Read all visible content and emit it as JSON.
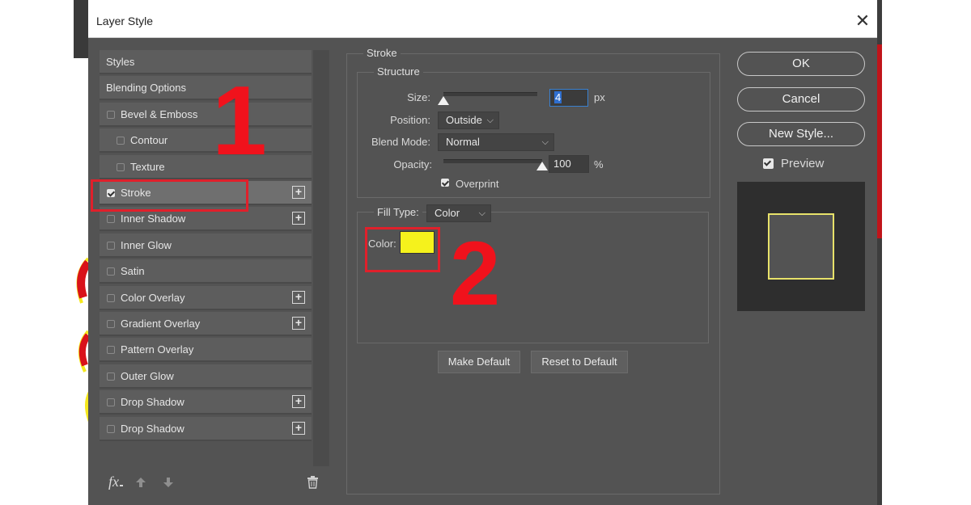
{
  "dialog": {
    "title": "Layer Style",
    "close": "✕"
  },
  "styles_list": [
    {
      "label": "Styles",
      "checkbox": false,
      "checked": false,
      "plus": false,
      "indent": false,
      "selected": false
    },
    {
      "label": "Blending Options",
      "checkbox": false,
      "checked": false,
      "plus": false,
      "indent": false,
      "selected": false
    },
    {
      "label": "Bevel & Emboss",
      "checkbox": true,
      "checked": false,
      "plus": false,
      "indent": false,
      "selected": false
    },
    {
      "label": "Contour",
      "checkbox": true,
      "checked": false,
      "plus": false,
      "indent": true,
      "selected": false
    },
    {
      "label": "Texture",
      "checkbox": true,
      "checked": false,
      "plus": false,
      "indent": true,
      "selected": false
    },
    {
      "label": "Stroke",
      "checkbox": true,
      "checked": true,
      "plus": true,
      "indent": false,
      "selected": true
    },
    {
      "label": "Inner Shadow",
      "checkbox": true,
      "checked": false,
      "plus": true,
      "indent": false,
      "selected": false
    },
    {
      "label": "Inner Glow",
      "checkbox": true,
      "checked": false,
      "plus": false,
      "indent": false,
      "selected": false
    },
    {
      "label": "Satin",
      "checkbox": true,
      "checked": false,
      "plus": false,
      "indent": false,
      "selected": false
    },
    {
      "label": "Color Overlay",
      "checkbox": true,
      "checked": false,
      "plus": true,
      "indent": false,
      "selected": false
    },
    {
      "label": "Gradient Overlay",
      "checkbox": true,
      "checked": false,
      "plus": true,
      "indent": false,
      "selected": false
    },
    {
      "label": "Pattern Overlay",
      "checkbox": true,
      "checked": false,
      "plus": false,
      "indent": false,
      "selected": false
    },
    {
      "label": "Outer Glow",
      "checkbox": true,
      "checked": false,
      "plus": false,
      "indent": false,
      "selected": false
    },
    {
      "label": "Drop Shadow",
      "checkbox": true,
      "checked": false,
      "plus": true,
      "indent": false,
      "selected": false
    },
    {
      "label": "Drop Shadow",
      "checkbox": true,
      "checked": false,
      "plus": true,
      "indent": false,
      "selected": false
    }
  ],
  "bottom_bar": {
    "fx": "fx",
    "icons": [
      "fx-icon",
      "arrow-up-icon",
      "arrow-down-icon",
      "trash-icon"
    ]
  },
  "stroke": {
    "group_title": "Stroke",
    "structure_title": "Structure",
    "size_label": "Size:",
    "size_value": "4",
    "size_unit": "px",
    "size_level": 0.0,
    "position_label": "Position:",
    "position_value": "Outside",
    "blend_label": "Blend Mode:",
    "blend_value": "Normal",
    "opacity_label": "Opacity:",
    "opacity_value": "100",
    "opacity_unit": "%",
    "opacity_level": 1.0,
    "overprint_label": "Overprint",
    "overprint_checked": true,
    "fill_type_label": "Fill Type:",
    "fill_type_value": "Color",
    "color_label": "Color:",
    "color_hex": "#f5f21c",
    "make_default": "Make Default",
    "reset_default": "Reset to Default"
  },
  "right_panel": {
    "ok": "OK",
    "cancel": "Cancel",
    "new_style": "New Style...",
    "preview_label": "Preview",
    "preview_checked": true,
    "preview_stroke_color": "#e8e26a"
  },
  "annotations": {
    "one": "1",
    "two": "2",
    "color": "#e0202b"
  },
  "chevron": "⌵"
}
